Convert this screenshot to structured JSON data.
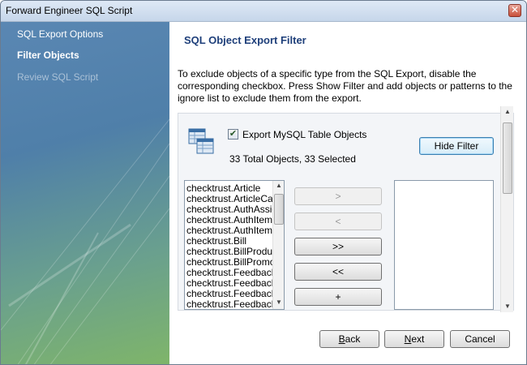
{
  "window": {
    "title": "Forward Engineer SQL Script",
    "close_glyph": "✕"
  },
  "sidebar": {
    "items": [
      {
        "label": "SQL Export Options",
        "state": "done"
      },
      {
        "label": "Filter Objects",
        "state": "current"
      },
      {
        "label": "Review SQL Script",
        "state": "pending"
      }
    ]
  },
  "main": {
    "heading": "SQL Object Export Filter",
    "description": "To exclude objects of a specific type from the SQL Export, disable the corresponding checkbox. Press Show Filter and add objects or patterns to the ignore list to exclude them from the export.",
    "export_checkbox": {
      "label": "Export MySQL Table Objects",
      "checked": true,
      "glyph": "✔"
    },
    "count_text": "33 Total Objects, 33 Selected",
    "hide_filter_label": "Hide Filter",
    "object_list": [
      "checktrust.Article",
      "checktrust.ArticleCate",
      "checktrust.AuthAssig",
      "checktrust.AuthItem",
      "checktrust.AuthItemC",
      "checktrust.Bill",
      "checktrust.BillProduct",
      "checktrust.BillPromo",
      "checktrust.Feedback",
      "checktrust.FeedbackI",
      "checktrust.FeedbackI",
      "checktrust.FeedbackT"
    ],
    "move_buttons": [
      {
        "label": ">",
        "enabled": false
      },
      {
        "label": "<",
        "enabled": false
      },
      {
        "label": ">>",
        "enabled": true
      },
      {
        "label": "<<",
        "enabled": true
      },
      {
        "label": "+",
        "enabled": true
      }
    ],
    "ignore_list": []
  },
  "footer": {
    "back": {
      "label_first": "B",
      "label_rest": "ack"
    },
    "next": {
      "label_first": "N",
      "label_rest": "ext"
    },
    "cancel": "Cancel"
  },
  "colors": {
    "heading": "#1e3f7a",
    "sidebar_top": "#5a87b3",
    "sidebar_bottom": "#7fb569"
  }
}
